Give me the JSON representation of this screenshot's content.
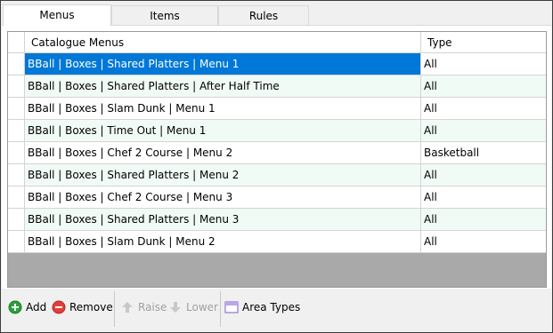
{
  "tabs": [
    {
      "label": "Menus",
      "active": true
    },
    {
      "label": "Items",
      "active": false
    },
    {
      "label": "Rules",
      "active": false
    }
  ],
  "grid": {
    "columns": [
      "Catalogue Menus",
      "Type"
    ],
    "rows": [
      {
        "name": "BBall | Boxes | Shared Platters | Menu 1",
        "type": "All",
        "selected": true
      },
      {
        "name": "BBall | Boxes | Shared Platters | After Half Time",
        "type": "All"
      },
      {
        "name": "BBall | Boxes | Slam Dunk | Menu 1",
        "type": "All"
      },
      {
        "name": "BBall | Boxes | Time Out | Menu 1",
        "type": "All"
      },
      {
        "name": "BBall | Boxes | Chef 2 Course | Menu 2",
        "type": "Basketball"
      },
      {
        "name": "BBall | Boxes | Shared Platters | Menu 2",
        "type": "All"
      },
      {
        "name": "BBall | Boxes | Chef 2 Course | Menu 3",
        "type": "All"
      },
      {
        "name": "BBall | Boxes | Shared Platters | Menu 3",
        "type": "All"
      },
      {
        "name": "BBall | Boxes | Slam Dunk | Menu 2",
        "type": "All"
      }
    ]
  },
  "toolbar": {
    "add_label": "Add",
    "remove_label": "Remove",
    "raise_label": "Raise",
    "lower_label": "Lower",
    "area_types_label": "Area Types",
    "icons": [
      "add-icon",
      "remove-icon",
      "arrow-up-icon",
      "arrow-down-icon",
      "window-icon"
    ]
  },
  "colors": {
    "selection": "#0078d7",
    "alt_row": "#f1fbf6",
    "empty_area": "#a9a9a9",
    "add_green": "#2e9e3a",
    "remove_red": "#e0403a"
  }
}
